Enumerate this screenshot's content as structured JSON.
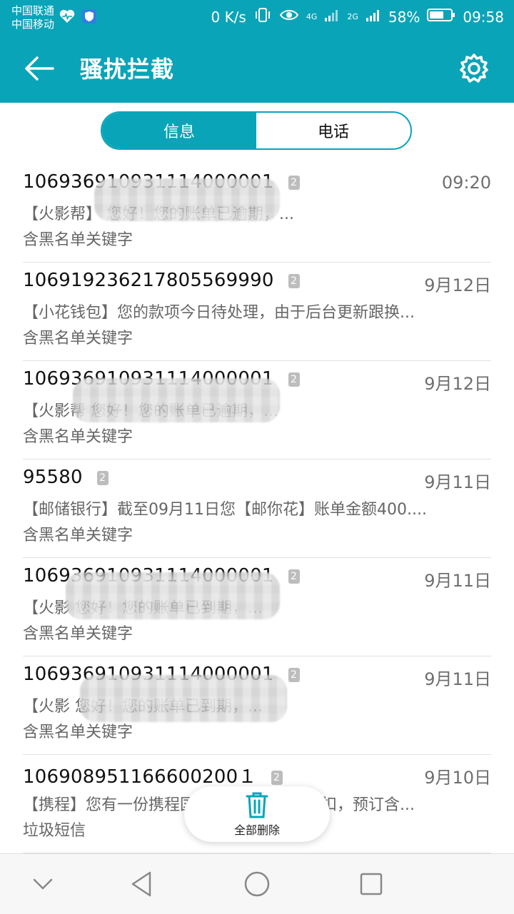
{
  "statusbar": {
    "carrier1": "中国联通",
    "carrier2": "中国移动",
    "speed": "0 K/s",
    "net1": "4G",
    "net2": "2G",
    "battery": "58%",
    "time": "09:58",
    "icons": [
      "heart-monitor-icon",
      "shield-icon",
      "vibrate-icon",
      "eye-icon",
      "signal-icon",
      "battery-icon"
    ]
  },
  "appbar": {
    "title": "骚扰拦截",
    "accent": "#0aa4b8"
  },
  "tabs": [
    {
      "label": "信息",
      "active": true
    },
    {
      "label": "电话",
      "active": false
    }
  ],
  "messages": [
    {
      "sender": "106936910931114000001",
      "sim": "2",
      "time": "09:20",
      "preview": "【火影帮】                您好！您的账单已逾期，...",
      "tag": "含黑名单关键字"
    },
    {
      "sender": "106919236217805569990",
      "sim": "2",
      "time": "9月12日",
      "preview": "【小花钱包】您的款项今日待处理，由于后台更新跟换...",
      "tag": "含黑名单关键字"
    },
    {
      "sender": "106936910931114000001",
      "sim": "2",
      "time": "9月12日",
      "preview": "【火影帮                您好！您的账单已逾期，...",
      "tag": "含黑名单关键字"
    },
    {
      "sender": "95580",
      "sim": "2",
      "time": "9月11日",
      "preview": "【邮储银行】截至09月11日您【邮你花】账单金额400....",
      "tag": "含黑名单关键字"
    },
    {
      "sender": "106936910931114000001",
      "sim": "2",
      "time": "9月11日",
      "preview": "【火影                 您好！您的账单已到期，...",
      "tag": "含黑名单关键字"
    },
    {
      "sender": "106936910931114000001",
      "sim": "2",
      "time": "9月11日",
      "preview": "【火影                  您好！您的账单已到期，...",
      "tag": "含黑名单关键字"
    },
    {
      "sender": "106908951166600200１",
      "sim": "2",
      "time": "9月10日",
      "preview": "【携程】您有一份携程国内机票预订专属折扣，预订含...",
      "tag": "垃圾短信"
    }
  ],
  "fab": {
    "label": "全部删除"
  },
  "navbar": {
    "icons": [
      "chevron-down-icon",
      "back-triangle-icon",
      "home-circle-icon",
      "recents-square-icon"
    ]
  }
}
